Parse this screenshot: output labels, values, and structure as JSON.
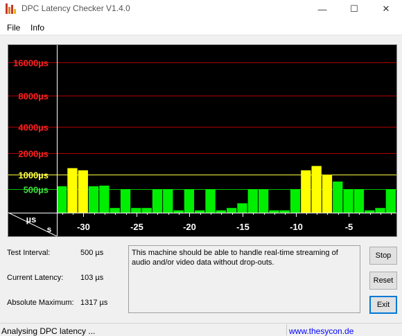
{
  "window": {
    "title": "DPC Latency Checker V1.4.0",
    "minimize_glyph": "—",
    "maximize_glyph": "☐",
    "close_glyph": "✕"
  },
  "menu": [
    "File",
    "Info"
  ],
  "chart_data": {
    "type": "bar",
    "ylabel": "µs",
    "xlabel": "s",
    "y_scale": "nonlinear (log-like)",
    "y_ticks": [
      {
        "label": "16000µs",
        "value": 16000,
        "color": "#ff2020"
      },
      {
        "label": "8000µs",
        "value": 8000,
        "color": "#ff2020"
      },
      {
        "label": "4000µs",
        "value": 4000,
        "color": "#ff2020"
      },
      {
        "label": "2000µs",
        "value": 2000,
        "color": "#ff2020"
      },
      {
        "label": "1000µs",
        "value": 1000,
        "color": "#ffff40"
      },
      {
        "label": "500µs",
        "value": 500,
        "color": "#40e040"
      }
    ],
    "x_ticks": [
      {
        "label": "-30",
        "value": -30
      },
      {
        "label": "-25",
        "value": -25
      },
      {
        "label": "-20",
        "value": -20
      },
      {
        "label": "-15",
        "value": -15
      },
      {
        "label": "-10",
        "value": -10
      },
      {
        "label": "-5",
        "value": -5
      }
    ],
    "xlim": [
      -32.5,
      -0.5
    ],
    "x": [
      -32,
      -31,
      -30,
      -29,
      -28,
      -27,
      -26,
      -25,
      -24,
      -23,
      -22,
      -21,
      -20,
      -19,
      -18,
      -17,
      -16,
      -15,
      -14,
      -13,
      -12,
      -11,
      -10,
      -9,
      -8,
      -7,
      -6,
      -5,
      -4,
      -3,
      -2,
      -1
    ],
    "values": [
      600,
      1300,
      1200,
      600,
      620,
      100,
      500,
      100,
      100,
      500,
      500,
      50,
      500,
      50,
      500,
      50,
      100,
      200,
      500,
      500,
      50,
      50,
      500,
      1200,
      1400,
      1000,
      760,
      500,
      500,
      50,
      100,
      500
    ],
    "bar_color_normal": "#00ee00",
    "bar_color_warning": "#ffff00",
    "warning_threshold": 1000,
    "grid": true,
    "grid_color_high": "#b00000",
    "grid_color_mid": "#ffff40",
    "grid_color_low": "#00c000"
  },
  "stats": {
    "test_interval_label": "Test Interval:",
    "test_interval_value": "500 µs",
    "current_latency_label": "Current Latency:",
    "current_latency_value": "103 µs",
    "absolute_maximum_label": "Absolute Maximum:",
    "absolute_maximum_value": "1317 µs"
  },
  "message": "This machine should be able to handle real-time streaming of audio and/or video data without drop-outs.",
  "buttons": {
    "stop": "Stop",
    "reset": "Reset",
    "exit": "Exit"
  },
  "status": {
    "text": "Analysing DPC latency ...",
    "link": "www.thesycon.de"
  }
}
